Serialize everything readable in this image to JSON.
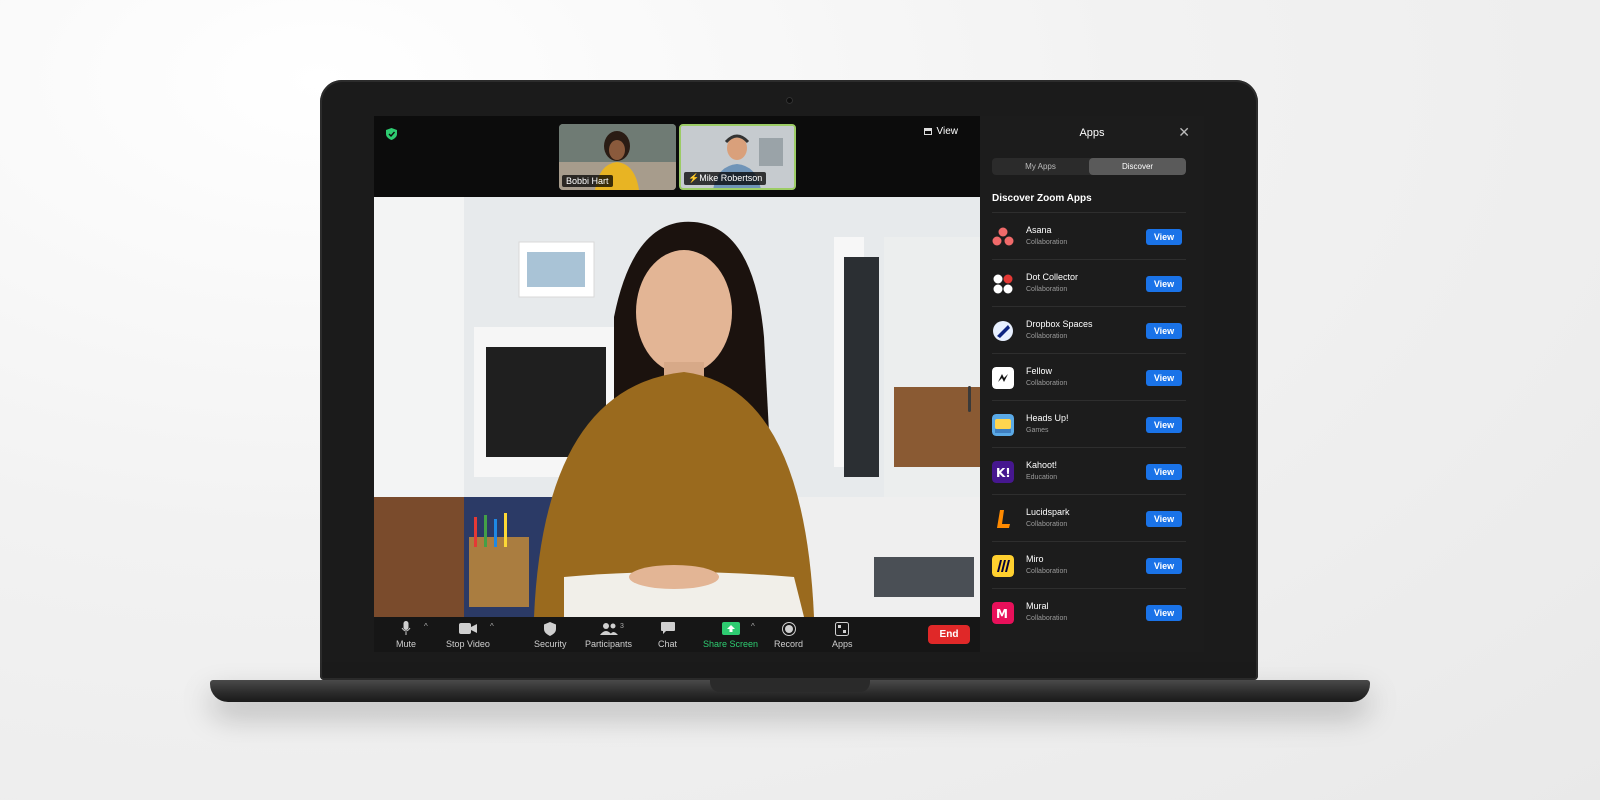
{
  "meeting": {
    "view_label": "View",
    "participants_thumbs": [
      {
        "name": "Bobbi Hart"
      },
      {
        "name": "Mike Robertson"
      }
    ]
  },
  "toolbar": {
    "mute": "Mute",
    "stop_video": "Stop Video",
    "security": "Security",
    "participants": "Participants",
    "participants_count": "3",
    "chat": "Chat",
    "share_screen": "Share Screen",
    "record": "Record",
    "apps": "Apps",
    "end": "End"
  },
  "apps_panel": {
    "title": "Apps",
    "tabs": [
      {
        "label": "My Apps",
        "active": false
      },
      {
        "label": "Discover",
        "active": true
      }
    ],
    "section_title": "Discover Zoom Apps",
    "view_label": "View",
    "apps": [
      {
        "name": "Asana",
        "category": "Collaboration",
        "icon": "asana-icon"
      },
      {
        "name": "Dot Collector",
        "category": "Collaboration",
        "icon": "dot-collector-icon"
      },
      {
        "name": "Dropbox Spaces",
        "category": "Collaboration",
        "icon": "dropbox-spaces-icon"
      },
      {
        "name": "Fellow",
        "category": "Collaboration",
        "icon": "fellow-icon"
      },
      {
        "name": "Heads Up!",
        "category": "Games",
        "icon": "heads-up-icon"
      },
      {
        "name": "Kahoot!",
        "category": "Education",
        "icon": "kahoot-icon"
      },
      {
        "name": "Lucidspark",
        "category": "Collaboration",
        "icon": "lucidspark-icon"
      },
      {
        "name": "Miro",
        "category": "Collaboration",
        "icon": "miro-icon"
      },
      {
        "name": "Mural",
        "category": "Collaboration",
        "icon": "mural-icon"
      }
    ]
  },
  "colors": {
    "accent_blue": "#1a73e8",
    "end_red": "#e02828",
    "share_green": "#2ecc71"
  }
}
